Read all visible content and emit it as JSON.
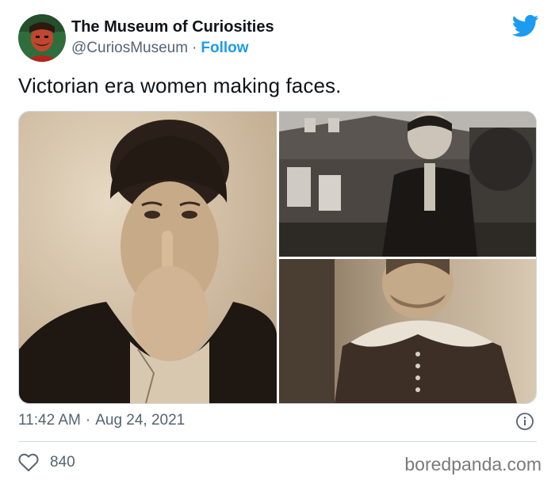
{
  "author": {
    "display_name": "The Museum of Curiosities",
    "handle": "@CuriosMuseum",
    "separator": "·",
    "follow_label": "Follow"
  },
  "tweet": {
    "text": "Victorian era women making faces."
  },
  "media": {
    "photos": [
      {
        "subject": "woman-thumbing-nose"
      },
      {
        "subject": "woman-pulling-face-in-front-of-house"
      },
      {
        "subject": "woman-pulling-cheeks"
      }
    ]
  },
  "meta": {
    "time": "11:42 AM",
    "separator": "·",
    "date": "Aug 24, 2021"
  },
  "engagement": {
    "likes": "840"
  },
  "watermark": "boredpanda.com",
  "colors": {
    "accent": "#1d9bf0",
    "secondary_text": "#536471",
    "primary_text": "#0f1419",
    "sepia_light": "#d9c7ad",
    "sepia_dark": "#3a2c22"
  },
  "icons": {
    "brand": "twitter-bird-icon",
    "info": "info-icon",
    "like": "heart-icon"
  }
}
